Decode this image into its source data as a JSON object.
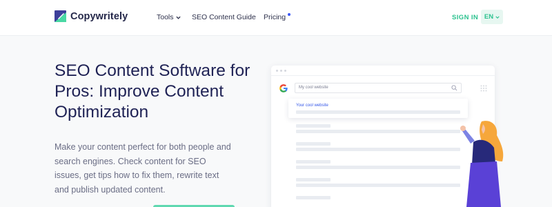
{
  "header": {
    "brand": "Copywritely",
    "nav": {
      "tools": "Tools",
      "guide": "SEO Content Guide",
      "pricing": "Pricing"
    },
    "sign_in": "SIGN IN",
    "language": "EN"
  },
  "hero": {
    "title": "SEO Content Software for Pros: Improve Content Optimization",
    "description": "Make your content perfect for both people and search engines. Check content for SEO issues, get tips how to fix them, rewrite text and publish updated content."
  },
  "mockup": {
    "search_text": "My cool website",
    "result_title": "Your cool website"
  },
  "colors": {
    "brand_green": "#2cc28f",
    "title_navy": "#1f2255",
    "result_link_blue": "#3557e8",
    "pricing_dot_blue": "#3a56f5"
  },
  "icons": {
    "logo": "copywritely-logo-icon",
    "tools_chevron": "chevron-down-icon",
    "language_chevron": "chevron-down-icon",
    "search_engine": "google-logo-icon",
    "search": "search-icon",
    "apps": "grid-icon"
  }
}
